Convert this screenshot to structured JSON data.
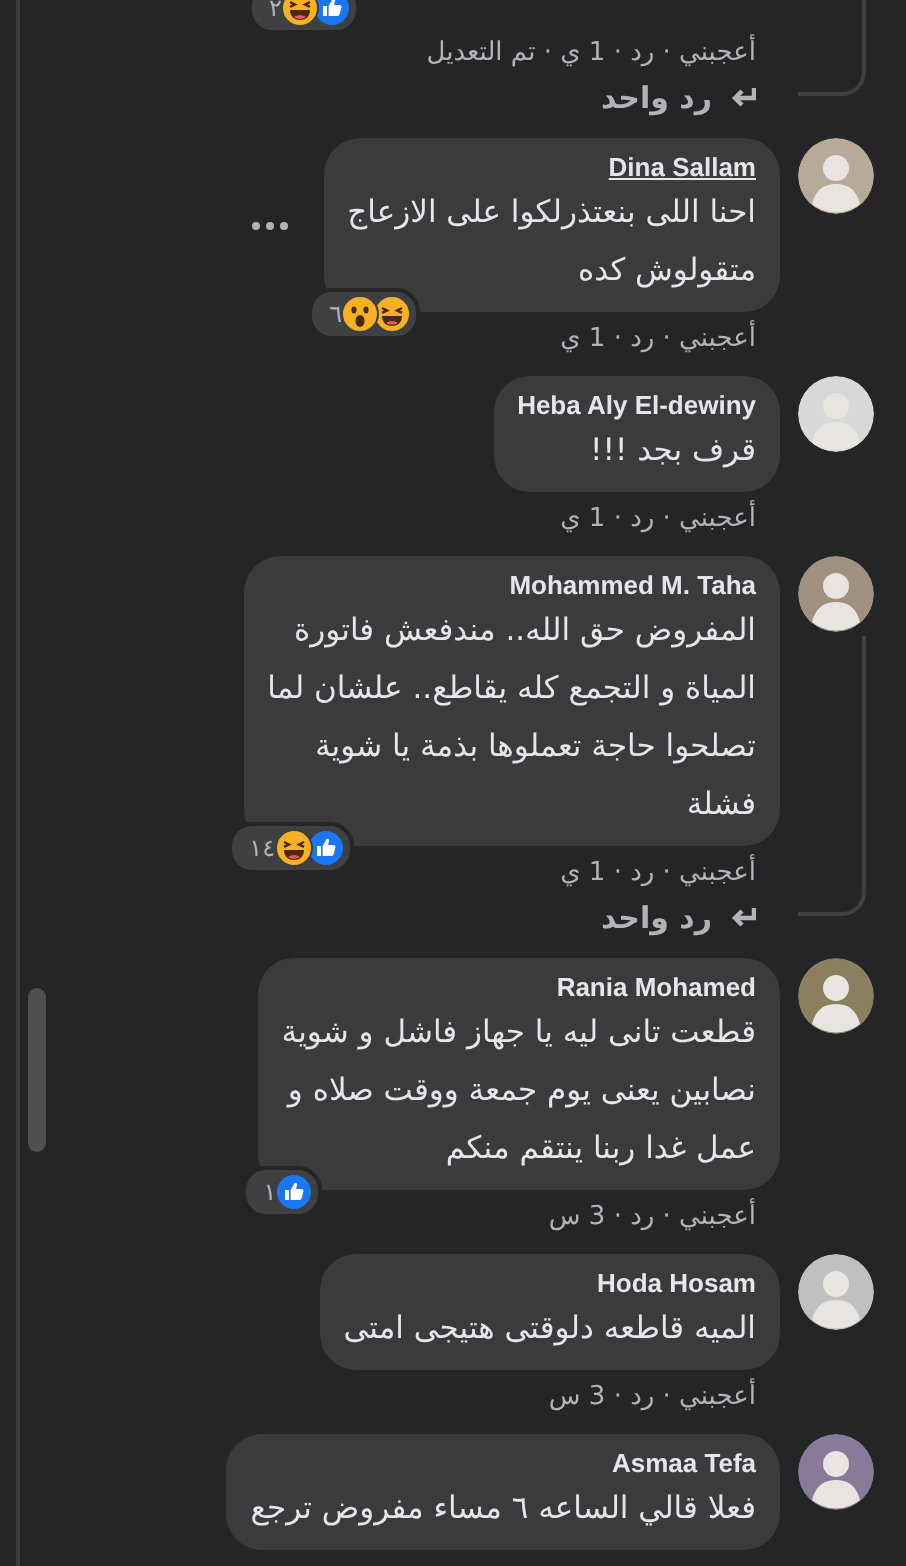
{
  "comments": [
    {
      "kind": "fragment",
      "reactions": {
        "count": "٢",
        "icons": [
          {
            "kind": "like"
          },
          {
            "kind": "haha"
          }
        ]
      },
      "meta": "أعجبني · رد · 1 ي · تم التعديل",
      "replies": "رد واحد"
    },
    {
      "kind": "comment",
      "author": "Dina Sallam",
      "author_underlined": true,
      "lines": [
        "احنا اللى بنعتذرلكوا على الازعاج",
        "متقولوش كده"
      ],
      "more_button": true,
      "reactions": {
        "count": "٦",
        "icons": [
          {
            "kind": "haha"
          },
          {
            "kind": "wow"
          }
        ]
      },
      "meta": "أعجبني · رد · 1 ي"
    },
    {
      "kind": "comment",
      "author": "Heba Aly El-dewiny",
      "author_underlined": false,
      "lines": [
        "قرف بجد !!!"
      ],
      "more_button": false,
      "meta": "أعجبني · رد · 1 ي"
    },
    {
      "kind": "comment",
      "author": "Mohammed M. Taha",
      "author_underlined": false,
      "lines": [
        "المفروض حق الله.. مندفعش فاتورة",
        "المياة و التجمع كله يقاطع.. علشان لما",
        "تصلحوا حاجة تعملوها بذمة يا شوية",
        "فشلة"
      ],
      "more_button": false,
      "reactions": {
        "count": "١٤",
        "icons": [
          {
            "kind": "like"
          },
          {
            "kind": "haha"
          }
        ]
      },
      "meta": "أعجبني · رد · 1 ي",
      "replies": "رد واحد"
    },
    {
      "kind": "comment",
      "author": "Rania Mohamed",
      "author_underlined": false,
      "lines": [
        "قطعت تانى ليه يا جهاز فاشل و شوية",
        "نصابين يعنى يوم جمعة ووقت صلاه و",
        "عمل غدا ربنا ينتقم منكم"
      ],
      "more_button": false,
      "reactions": {
        "count": "١",
        "icons": [
          {
            "kind": "like"
          }
        ]
      },
      "meta": "أعجبني · رد · 3 س"
    },
    {
      "kind": "comment",
      "author": "Hoda Hosam",
      "author_underlined": false,
      "lines": [
        "الميه قاطعه دلوقتى هتيجى امتى"
      ],
      "more_button": false,
      "meta": "أعجبني · رد · 3 س"
    },
    {
      "kind": "comment",
      "author": "Asmaa Tefa",
      "author_underlined": false,
      "lines": [
        "فعلا قالي الساعه ٦ مساء مفروض ترجع"
      ],
      "more_button": false
    }
  ]
}
